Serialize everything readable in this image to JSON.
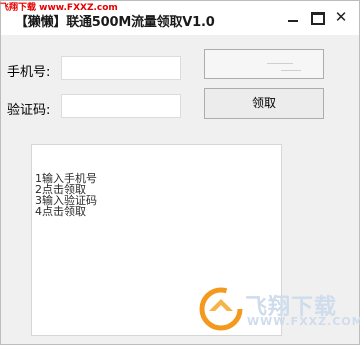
{
  "watermark": {
    "top_left": "飞翔下载 www.FXXZ.com",
    "logo_text": "飞翔下载",
    "logo_url": "WWW.FXXZ.COM"
  },
  "window": {
    "title": "【獭懒】联通500M流量领取V1.0",
    "controls": {
      "minimize_icon": "minimize-icon",
      "maximize_icon": "maximize-icon",
      "close_icon": "close-icon",
      "close_glyph": "✕"
    }
  },
  "form": {
    "phone_label": "手机号:",
    "phone_value": "",
    "code_label": "验证码:",
    "code_value": "",
    "claim_button": "领取",
    "captcha_text": "二"
  },
  "output": {
    "lines": [
      "1输入手机号",
      "2点击领取",
      "3输入验证码",
      "4点击领取"
    ]
  },
  "colors": {
    "window_bg": "#f0f0f0",
    "titlebar_bg": "#ffffff",
    "watermark_red": "#e60000",
    "logo_orange": "#f39a1e",
    "logo_text": "#cfdcec"
  }
}
